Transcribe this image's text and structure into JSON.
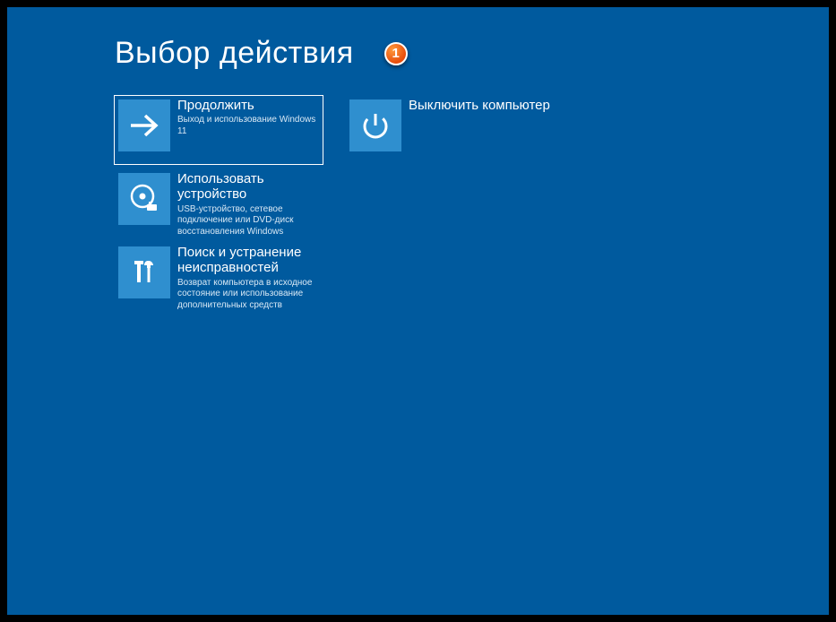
{
  "header": {
    "title": "Выбор действия",
    "annotation_number": "1"
  },
  "tiles": {
    "continue": {
      "title": "Продолжить",
      "desc": "Выход и использование Windows 11"
    },
    "shutdown": {
      "title": "Выключить компьютер"
    },
    "use_device": {
      "title": "Использовать устройство",
      "desc": "USB-устройство, сетевое подключение или DVD-диск восстановления Windows"
    },
    "troubleshoot": {
      "title": "Поиск и устранение неисправностей",
      "desc": "Возврат компьютера в исходное состояние или использование дополнительных средств"
    }
  }
}
